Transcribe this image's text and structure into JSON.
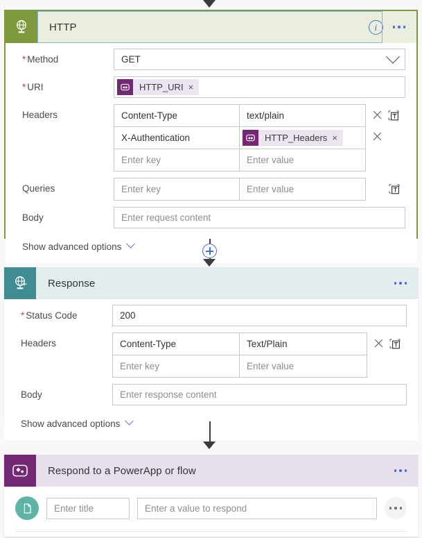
{
  "flow": {
    "connectors": {
      "top_arrow": "arrow-down",
      "insert_button": "+"
    }
  },
  "http_card": {
    "title": "HTTP",
    "icon": "globe-http-icon",
    "accent_color": "#7f9a3c",
    "header_bg": "#eaeedc",
    "selected": true,
    "info_label": "i",
    "more_label": "...",
    "method": {
      "label": "Method",
      "required": true,
      "value": "GET",
      "chevron": "chevron-down-icon"
    },
    "uri": {
      "label": "URI",
      "required": true,
      "token": {
        "text": "HTTP_URI",
        "icon": "powerapps-token-icon",
        "remove": "×"
      }
    },
    "headers": {
      "label": "Headers",
      "rows": [
        {
          "key": "Content-Type",
          "value": "text/plain",
          "value_is_token": false,
          "has_delete": true,
          "has_text_mode": true
        },
        {
          "key": "X-Authentication",
          "value": "HTTP_Headers",
          "value_is_token": true,
          "has_delete": true,
          "has_text_mode": false
        },
        {
          "key": "Enter key",
          "value": "Enter value",
          "is_placeholder": true,
          "has_delete": false,
          "has_text_mode": false
        }
      ]
    },
    "queries": {
      "label": "Queries",
      "key_placeholder": "Enter key",
      "value_placeholder": "Enter value",
      "has_text_mode": true
    },
    "body": {
      "label": "Body",
      "placeholder": "Enter request content"
    },
    "advanced": {
      "label": "Show advanced options",
      "chevron": "chevron-down-icon"
    }
  },
  "response_card": {
    "title": "Response",
    "icon": "globe-response-icon",
    "header_bg": "#e4edee",
    "badge_color": "#3f8c93",
    "more_label": "...",
    "status_code": {
      "label": "Status Code",
      "required": true,
      "value": "200"
    },
    "headers": {
      "label": "Headers",
      "rows": [
        {
          "key": "Content-Type",
          "value": "Text/Plain",
          "has_delete": true,
          "has_text_mode": true
        },
        {
          "key": "Enter key",
          "value": "Enter value",
          "is_placeholder": true,
          "has_delete": false,
          "has_text_mode": false
        }
      ]
    },
    "body": {
      "label": "Body",
      "placeholder": "Enter response content"
    },
    "advanced": {
      "label": "Show advanced options",
      "chevron": "chevron-down-icon"
    }
  },
  "powerapp_card": {
    "title": "Respond to a PowerApp or flow",
    "icon": "powerapps-icon",
    "header_bg": "#e7dfec",
    "badge_color": "#742774",
    "more_label": "...",
    "output_type_icon": "text-output-icon",
    "title_placeholder": "Enter title",
    "value_placeholder": "Enter a value to respond",
    "row_more_label": "..."
  }
}
